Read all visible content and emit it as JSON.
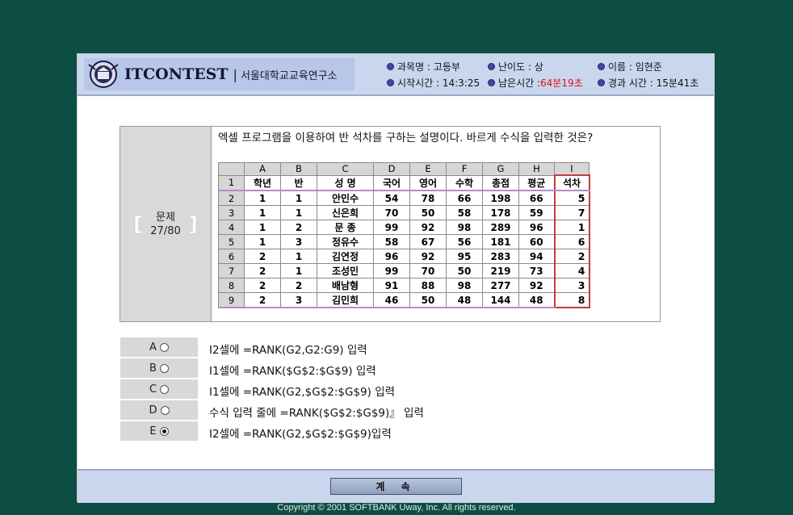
{
  "header": {
    "brand": "ITCONTEST",
    "org": "서울대학교교육연구소",
    "subject_label": "과목명 : 고등부",
    "difficulty_label": "난이도 : 상",
    "name_label": "이름 : 임현준",
    "start_label": "시작시간 : 14:3:25",
    "remaining_prefix": "남은시간 : ",
    "remaining_value": "64분19초",
    "elapsed_label": "경과 시간 : 15분41초"
  },
  "question": {
    "label": "문제",
    "number": "27/80",
    "text": "엑셀 프로그램을 이용하여 반 석차를 구하는 설명이다. 바르게 수식을 입력한 것은?"
  },
  "sheet": {
    "columns": [
      "",
      "A",
      "B",
      "C",
      "D",
      "E",
      "F",
      "G",
      "H",
      "I"
    ],
    "header_row": {
      "num": "1",
      "cells": [
        "학년",
        "반",
        "성 명",
        "국어",
        "영어",
        "수학",
        "총점",
        "평균",
        "석차"
      ]
    },
    "rows": [
      {
        "num": "2",
        "cells": [
          "1",
          "1",
          "안민수",
          "54",
          "78",
          "66",
          "198",
          "66",
          "5"
        ]
      },
      {
        "num": "3",
        "cells": [
          "1",
          "1",
          "신은희",
          "70",
          "50",
          "58",
          "178",
          "59",
          "7"
        ]
      },
      {
        "num": "4",
        "cells": [
          "1",
          "2",
          "문  종",
          "99",
          "92",
          "98",
          "289",
          "96",
          "1"
        ]
      },
      {
        "num": "5",
        "cells": [
          "1",
          "3",
          "정유수",
          "58",
          "67",
          "56",
          "181",
          "60",
          "6"
        ]
      },
      {
        "num": "6",
        "cells": [
          "2",
          "1",
          "김연정",
          "96",
          "92",
          "95",
          "283",
          "94",
          "2"
        ]
      },
      {
        "num": "7",
        "cells": [
          "2",
          "1",
          "조성민",
          "99",
          "70",
          "50",
          "219",
          "73",
          "4"
        ]
      },
      {
        "num": "8",
        "cells": [
          "2",
          "2",
          "배남형",
          "91",
          "88",
          "98",
          "277",
          "92",
          "3"
        ]
      },
      {
        "num": "9",
        "cells": [
          "2",
          "3",
          "김민희",
          "46",
          "50",
          "48",
          "144",
          "48",
          "8"
        ]
      }
    ]
  },
  "options": [
    {
      "letter": "A",
      "text": "I2셀에 =RANK(G2,G2:G9) 입력",
      "selected": false
    },
    {
      "letter": "B",
      "text": "I1셀에 =RANK($G$2:$G$9) 입력",
      "selected": false
    },
    {
      "letter": "C",
      "text": "I1셀에 =RANK(G2,$G$2:$G$9) 입력",
      "selected": false
    },
    {
      "letter": "D",
      "text": "수식 입력 줄에 =RANK($G$2:$G$9)』 입력",
      "selected": false
    },
    {
      "letter": "E",
      "text": "I2셀에 =RANK(G2,$G$2:$G$9)입력",
      "selected": true
    }
  ],
  "footer": {
    "continue_label": "계 속",
    "copyright": "Copyright © 2001 SOFTBANK Uway, Inc. All rights reserved."
  },
  "colors": {
    "background": "#0d4e44",
    "header": "#c9d6ee",
    "remaining_time": "#e01010"
  }
}
